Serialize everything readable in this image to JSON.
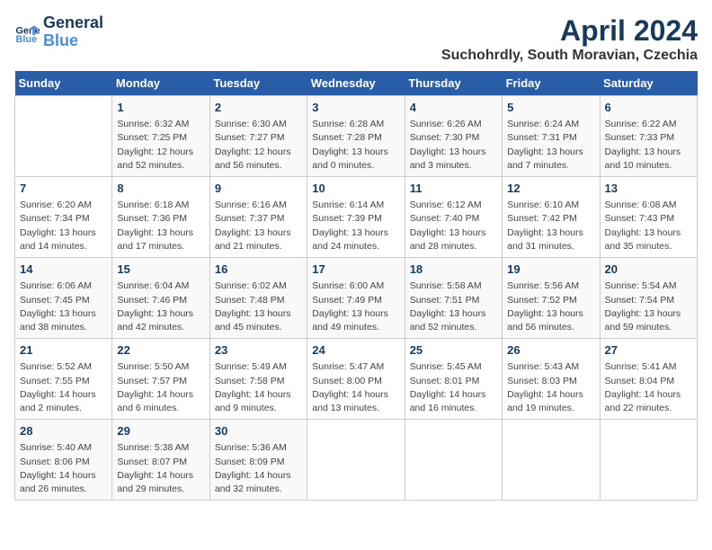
{
  "header": {
    "logo_line1": "General",
    "logo_line2": "Blue",
    "title": "April 2024",
    "subtitle": "Suchohrdly, South Moravian, Czechia"
  },
  "weekdays": [
    "Sunday",
    "Monday",
    "Tuesday",
    "Wednesday",
    "Thursday",
    "Friday",
    "Saturday"
  ],
  "weeks": [
    [
      {
        "day": "",
        "info": ""
      },
      {
        "day": "1",
        "info": "Sunrise: 6:32 AM\nSunset: 7:25 PM\nDaylight: 12 hours\nand 52 minutes."
      },
      {
        "day": "2",
        "info": "Sunrise: 6:30 AM\nSunset: 7:27 PM\nDaylight: 12 hours\nand 56 minutes."
      },
      {
        "day": "3",
        "info": "Sunrise: 6:28 AM\nSunset: 7:28 PM\nDaylight: 13 hours\nand 0 minutes."
      },
      {
        "day": "4",
        "info": "Sunrise: 6:26 AM\nSunset: 7:30 PM\nDaylight: 13 hours\nand 3 minutes."
      },
      {
        "day": "5",
        "info": "Sunrise: 6:24 AM\nSunset: 7:31 PM\nDaylight: 13 hours\nand 7 minutes."
      },
      {
        "day": "6",
        "info": "Sunrise: 6:22 AM\nSunset: 7:33 PM\nDaylight: 13 hours\nand 10 minutes."
      }
    ],
    [
      {
        "day": "7",
        "info": "Sunrise: 6:20 AM\nSunset: 7:34 PM\nDaylight: 13 hours\nand 14 minutes."
      },
      {
        "day": "8",
        "info": "Sunrise: 6:18 AM\nSunset: 7:36 PM\nDaylight: 13 hours\nand 17 minutes."
      },
      {
        "day": "9",
        "info": "Sunrise: 6:16 AM\nSunset: 7:37 PM\nDaylight: 13 hours\nand 21 minutes."
      },
      {
        "day": "10",
        "info": "Sunrise: 6:14 AM\nSunset: 7:39 PM\nDaylight: 13 hours\nand 24 minutes."
      },
      {
        "day": "11",
        "info": "Sunrise: 6:12 AM\nSunset: 7:40 PM\nDaylight: 13 hours\nand 28 minutes."
      },
      {
        "day": "12",
        "info": "Sunrise: 6:10 AM\nSunset: 7:42 PM\nDaylight: 13 hours\nand 31 minutes."
      },
      {
        "day": "13",
        "info": "Sunrise: 6:08 AM\nSunset: 7:43 PM\nDaylight: 13 hours\nand 35 minutes."
      }
    ],
    [
      {
        "day": "14",
        "info": "Sunrise: 6:06 AM\nSunset: 7:45 PM\nDaylight: 13 hours\nand 38 minutes."
      },
      {
        "day": "15",
        "info": "Sunrise: 6:04 AM\nSunset: 7:46 PM\nDaylight: 13 hours\nand 42 minutes."
      },
      {
        "day": "16",
        "info": "Sunrise: 6:02 AM\nSunset: 7:48 PM\nDaylight: 13 hours\nand 45 minutes."
      },
      {
        "day": "17",
        "info": "Sunrise: 6:00 AM\nSunset: 7:49 PM\nDaylight: 13 hours\nand 49 minutes."
      },
      {
        "day": "18",
        "info": "Sunrise: 5:58 AM\nSunset: 7:51 PM\nDaylight: 13 hours\nand 52 minutes."
      },
      {
        "day": "19",
        "info": "Sunrise: 5:56 AM\nSunset: 7:52 PM\nDaylight: 13 hours\nand 56 minutes."
      },
      {
        "day": "20",
        "info": "Sunrise: 5:54 AM\nSunset: 7:54 PM\nDaylight: 13 hours\nand 59 minutes."
      }
    ],
    [
      {
        "day": "21",
        "info": "Sunrise: 5:52 AM\nSunset: 7:55 PM\nDaylight: 14 hours\nand 2 minutes."
      },
      {
        "day": "22",
        "info": "Sunrise: 5:50 AM\nSunset: 7:57 PM\nDaylight: 14 hours\nand 6 minutes."
      },
      {
        "day": "23",
        "info": "Sunrise: 5:49 AM\nSunset: 7:58 PM\nDaylight: 14 hours\nand 9 minutes."
      },
      {
        "day": "24",
        "info": "Sunrise: 5:47 AM\nSunset: 8:00 PM\nDaylight: 14 hours\nand 13 minutes."
      },
      {
        "day": "25",
        "info": "Sunrise: 5:45 AM\nSunset: 8:01 PM\nDaylight: 14 hours\nand 16 minutes."
      },
      {
        "day": "26",
        "info": "Sunrise: 5:43 AM\nSunset: 8:03 PM\nDaylight: 14 hours\nand 19 minutes."
      },
      {
        "day": "27",
        "info": "Sunrise: 5:41 AM\nSunset: 8:04 PM\nDaylight: 14 hours\nand 22 minutes."
      }
    ],
    [
      {
        "day": "28",
        "info": "Sunrise: 5:40 AM\nSunset: 8:06 PM\nDaylight: 14 hours\nand 26 minutes."
      },
      {
        "day": "29",
        "info": "Sunrise: 5:38 AM\nSunset: 8:07 PM\nDaylight: 14 hours\nand 29 minutes."
      },
      {
        "day": "30",
        "info": "Sunrise: 5:36 AM\nSunset: 8:09 PM\nDaylight: 14 hours\nand 32 minutes."
      },
      {
        "day": "",
        "info": ""
      },
      {
        "day": "",
        "info": ""
      },
      {
        "day": "",
        "info": ""
      },
      {
        "day": "",
        "info": ""
      }
    ]
  ]
}
